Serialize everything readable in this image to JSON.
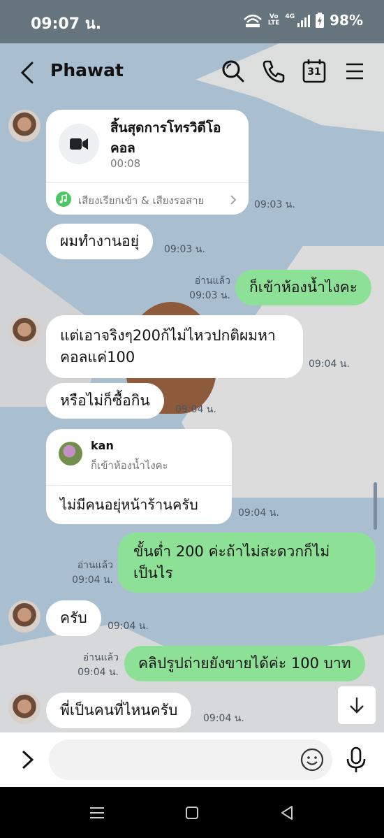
{
  "status": {
    "time": "09:07 น.",
    "volte_top": "Vo",
    "volte_bottom": "LTE",
    "network": "4G",
    "battery": "98%"
  },
  "header": {
    "title": "Phawat",
    "calendar_day": "31"
  },
  "messages": {
    "call": {
      "title": "สิ้นสุดการโทรวิดีโอคอล",
      "duration": "00:08",
      "footer": "เสียงเรียกเข้า & เสียงรอสาย",
      "time": "09:03 น."
    },
    "m1": {
      "text": "ผมทำงานอยุ่",
      "time": "09:03 น."
    },
    "m2": {
      "text": "ก็เข้าห้องน้ำไงคะ",
      "read": "อ่านแล้ว",
      "time": "09:03 น."
    },
    "m3": {
      "line1": "แต่เอาจริงๆ200ก้ไม่ไหวปกติผมหา",
      "line2": "คอลแค่100",
      "time": "09:04 น."
    },
    "m4": {
      "text": "หรือไม่ก็ซื้อกิน",
      "time": "09:04 น."
    },
    "m5": {
      "reply_name": "kan",
      "reply_quote": "ก็เข้าห้องน้ำไงคะ",
      "text": "ไม่มีคนอยุ่หน้าร้านครับ",
      "time": "09:04 น."
    },
    "m6": {
      "line1": "ขั้นต่ำ 200 ค่ะถ้าไม่สะดวกก็ไม่",
      "line2": "เป็นไร",
      "read": "อ่านแล้ว",
      "time": "09:04 น."
    },
    "m7": {
      "text": "ครับ",
      "time": "09:04 น."
    },
    "m8": {
      "text": "คลิปรูปถ่ายยังขายได้ค่ะ 100 บาท",
      "read": "อ่านแล้ว",
      "time": "09:04 น."
    },
    "m9": {
      "text": "พี่เป็นคนที่ไหนครับ",
      "time": "09:04 น."
    }
  },
  "input": {
    "placeholder": ""
  },
  "colors": {
    "outgoing": "#8de196",
    "incoming": "#ffffff",
    "background": "#a9bfd0",
    "accent": "#4cc764"
  },
  "icons": [
    "back-icon",
    "search-icon",
    "phone-icon",
    "calendar-icon",
    "menu-icon",
    "video-camera-icon",
    "music-icon",
    "chevron-right-icon",
    "arrow-down-icon",
    "chevron-right-icon",
    "emoji-icon",
    "mic-icon",
    "recents-icon",
    "home-icon",
    "back-nav-icon"
  ]
}
